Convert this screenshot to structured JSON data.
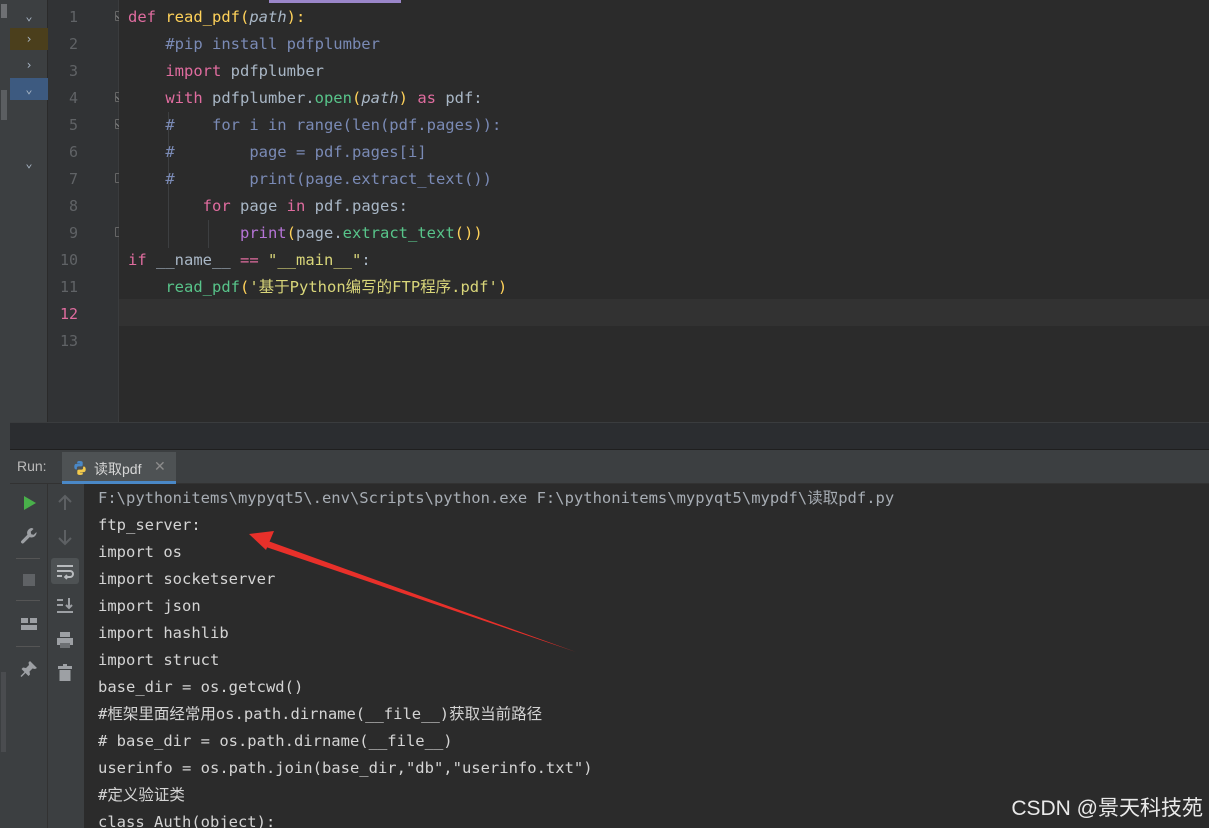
{
  "editor": {
    "line_numbers": [
      "1",
      "2",
      "3",
      "4",
      "5",
      "6",
      "7",
      "8",
      "9",
      "10",
      "11",
      "12",
      "13"
    ],
    "current_line": "12",
    "line1": {
      "kw_def": "def",
      "fn_name": "read_pdf",
      "paren_open": "(",
      "param": "path",
      "tail": "):"
    },
    "line2": {
      "comment": "#pip install pdfplumber"
    },
    "line3": {
      "kw": "import",
      "rest": " pdfplumber"
    },
    "line4": {
      "kw_with": "with",
      "obj": " pdfplumber.",
      "meth": "open",
      "p_open": "(",
      "param": "path",
      "p_close": ")",
      "kw_as": " as",
      "rest": " pdf:"
    },
    "line5": {
      "comment": "#    for i in range(len(pdf.pages)):"
    },
    "line6": {
      "comment": "#        page = pdf.pages[i]"
    },
    "line7": {
      "comment": "#        print(page.extract_text())"
    },
    "line8": {
      "kw_for": "for",
      "mid": " page ",
      "kw_in": "in",
      "rest": " pdf.pages:"
    },
    "line9": {
      "builtin": "print",
      "p_open": "(",
      "obj": "page.",
      "meth": "extract_text",
      "tail": "())"
    },
    "line10": {
      "kw_if": "if",
      "rest": " __name__ ",
      "op": "==",
      "str": " \"__main__\"",
      "colon": ":"
    },
    "line11": {
      "fn": "read_pdf",
      "p_open": "(",
      "str": "'基于Python编写的FTP程序.pdf'",
      "p_close": ")"
    }
  },
  "run_panel": {
    "label": "Run:",
    "tab_title": "读取pdf",
    "tab_close": "✕",
    "toolbar_left": [
      "run-icon",
      "wrench-icon",
      "stop-icon",
      "layout-icon",
      "pin-icon"
    ],
    "toolbar_right": [
      "up-arrow-icon",
      "down-arrow-icon",
      "soft-wrap-icon",
      "scroll-to-end-icon",
      "print-icon",
      "trash-icon"
    ]
  },
  "console": {
    "lines": [
      "F:\\pythonitems\\mypyqt5\\.env\\Scripts\\python.exe F:\\pythonitems\\mypyqt5\\mypdf\\读取pdf.py",
      "ftp_server:",
      "import os",
      "import socketserver",
      "import json",
      "import hashlib",
      "import struct",
      "base_dir = os.getcwd()",
      "#框架里面经常用os.path.dirname(__file__)获取当前路径",
      "# base_dir = os.path.dirname(__file__)",
      "userinfo = os.path.join(base_dir,\"db\",\"userinfo.txt\")",
      "#定义验证类",
      "class Auth(object):"
    ]
  },
  "watermark": "CSDN @景天科技苑",
  "colors": {
    "annotation_arrow": "#e8302a",
    "keyword": "#e06c9f",
    "function": "#ffd25a",
    "comment": "#7a8ab5",
    "run_green": "#49b04a"
  }
}
